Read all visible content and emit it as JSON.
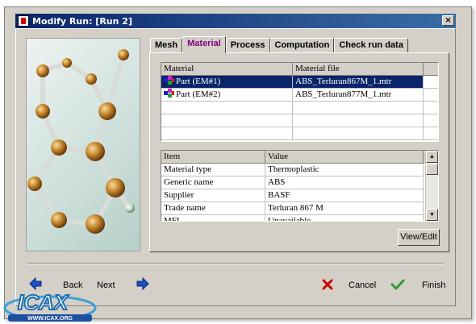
{
  "window": {
    "title": "Modify Run: [Run 2]",
    "close_glyph": "×"
  },
  "tabs": [
    {
      "label": "Mesh"
    },
    {
      "label": "Material",
      "active": true
    },
    {
      "label": "Process"
    },
    {
      "label": "Computation"
    },
    {
      "label": "Check run data"
    }
  ],
  "material_table": {
    "columns": [
      "Material",
      "Material file"
    ],
    "rows": [
      {
        "material": "Part (EM#1)",
        "file": "ABS_Terluran867M_1.mtr",
        "selected": true
      },
      {
        "material": "Part (EM#2)",
        "file": "ABS_Terluran877M_1.mtr",
        "selected": false
      }
    ]
  },
  "property_table": {
    "columns": [
      "Item",
      "Value"
    ],
    "rows": [
      {
        "item": "Material type",
        "value": "Thermoplastic"
      },
      {
        "item": "Generic name",
        "value": "ABS"
      },
      {
        "item": "Supplier",
        "value": "BASF"
      },
      {
        "item": "Trade name",
        "value": "Terluran 867 M"
      },
      {
        "item": "MFI",
        "value": "Unavailable"
      }
    ]
  },
  "buttons": {
    "view_edit": "View/Edit",
    "back": "Back",
    "next": "Next",
    "cancel": "Cancel",
    "finish": "Finish"
  },
  "logo": {
    "text": "ICAX",
    "url": "WWW.ICAX.ORG"
  },
  "colors": {
    "title_bar": "#0a246a",
    "selection": "#0a246a",
    "active_tab_text": "#800080",
    "cancel_icon": "#cc0000",
    "finish_icon": "#2e9a2e",
    "arrow_icon": "#1f4fbf"
  }
}
